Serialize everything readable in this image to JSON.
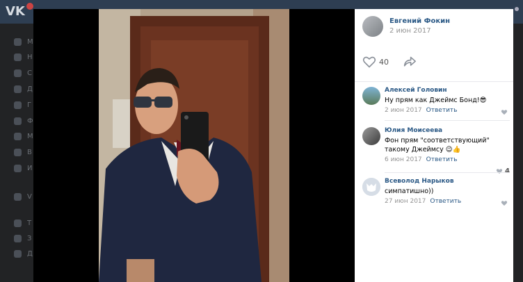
{
  "background": {
    "logo": "VK",
    "sidebar_letters": [
      "М",
      "Н",
      "С",
      "Д",
      "Г",
      "Ф",
      "М",
      "В",
      "И",
      "V",
      "Т",
      "З",
      "Д"
    ]
  },
  "post": {
    "author_name": "Евгений Фокин",
    "date": "2 июн 2017",
    "like_count": "40"
  },
  "comments": [
    {
      "name": "Алексей Головин",
      "text": "Ну прям как Джеймс Бонд!😎",
      "date": "2 июн 2017",
      "reply_label": "Ответить",
      "likes": ""
    },
    {
      "name": "Юлия Моисеева",
      "text": "Фон прям \"соответствующий\" такому Джеймсу 😉👍",
      "date": "6 июн 2017",
      "reply_label": "Ответить",
      "likes": "4"
    },
    {
      "name": "Всеволод Нарыков",
      "text": "симпатишно))",
      "date": "27 июн 2017",
      "reply_label": "Ответить",
      "likes": ""
    }
  ],
  "colors": {
    "link": "#2a5885",
    "meta": "#939393",
    "vk_header": "#2e3e52"
  }
}
